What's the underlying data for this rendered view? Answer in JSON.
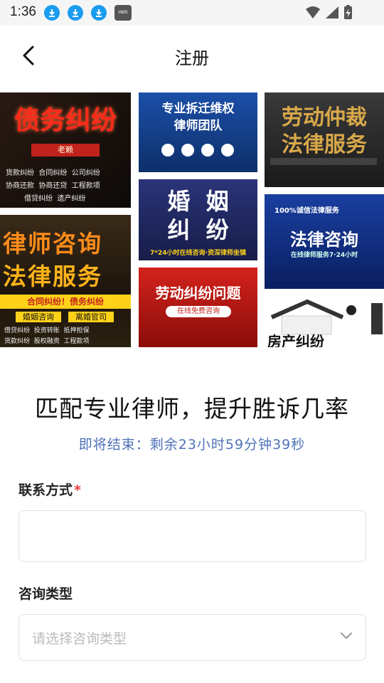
{
  "status": {
    "time": "1:36",
    "hms_label": "HMS"
  },
  "header": {
    "title": "注册"
  },
  "banner": {
    "tiles": [
      {
        "line1": "债务纠纷",
        "line2": "老赖",
        "sub1": "货款纠纷  合同纠纷  公司纠纷",
        "sub2": "协商还款  协商还贷  工程款项",
        "sub3": "借贷纠纷  遗产纠纷"
      },
      {
        "line1": "律师咨询",
        "line2": "法律服务",
        "ribbon": "合同纠纷！债务纠纷",
        "chip1": "婚姻咨询",
        "chip2": "离婚官司",
        "sub1": "借贷纠纷  投资转账  抵押担保",
        "sub2": "货款纠纷  股权融资  工程款项"
      },
      {
        "line1": "专业拆迁维权",
        "line2": "律师团队"
      },
      {
        "line1": "婚  姻",
        "line2": "纠  纷",
        "sub1": "7*24小时在线咨询·资深律师坐镇"
      },
      {
        "line1": "劳动纠纷问题",
        "sub1": "在线免费咨询"
      },
      {
        "line1": "劳动仲裁",
        "line2": "法律服务"
      },
      {
        "line1": "法律咨询",
        "sub1": "100%诚信法律服务",
        "sub2": "在线律师服务7·24小时"
      },
      {
        "line1": "房产纠纷"
      }
    ]
  },
  "headline": "匹配专业律师，提升胜诉几率",
  "countdown": "即将结束：剩余23小时59分钟39秒",
  "form": {
    "contact_label": "联系方式",
    "required_mark": "*",
    "contact_value": "",
    "consult_label": "咨询类型",
    "consult_placeholder": "请选择咨询类型"
  },
  "colors": {
    "accent": "#4f72b8",
    "required": "#e53935",
    "download_icon": "#1a9cf0"
  },
  "icons": [
    "download-icon",
    "download-icon",
    "download-icon",
    "hms-icon",
    "wifi-icon",
    "signal-icon",
    "battery-charging-icon",
    "back-arrow-icon",
    "chevron-down-icon"
  ]
}
